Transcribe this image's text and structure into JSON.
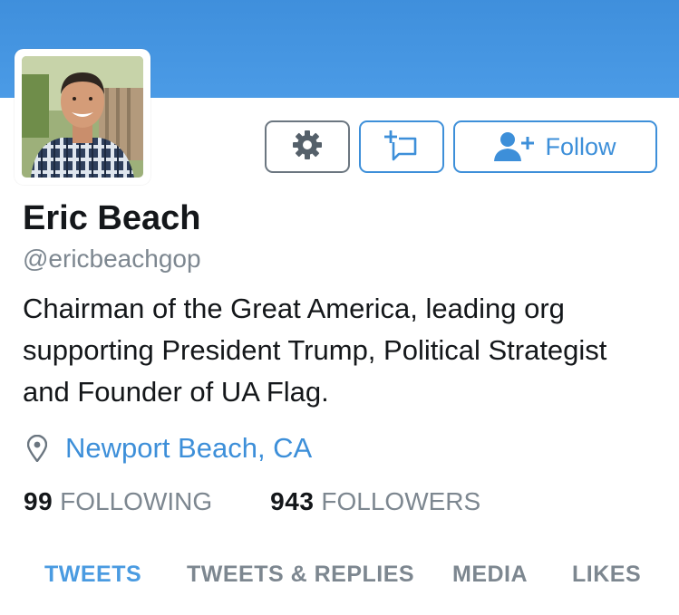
{
  "colors": {
    "banner": "#4b9be6",
    "accent": "#3d8fd9",
    "text_primary": "#14171a",
    "text_secondary": "#7d8790"
  },
  "profile": {
    "name": "Eric Beach",
    "handle": "@ericbeachgop",
    "bio": "Chairman of the Great America, leading org supporting President Trump, Political Strategist and Founder of UA Flag.",
    "location": "Newport Beach, CA"
  },
  "actions": {
    "settings_icon": "gear-icon",
    "message_icon": "compose-message-icon",
    "follow_icon": "add-user-icon",
    "follow_label": "Follow"
  },
  "stats": {
    "following_count": "99",
    "following_label": "FOLLOWING",
    "followers_count": "943",
    "followers_label": "FOLLOWERS"
  },
  "tabs": [
    {
      "label": "TWEETS",
      "active": true
    },
    {
      "label": "TWEETS & REPLIES",
      "active": false
    },
    {
      "label": "MEDIA",
      "active": false
    },
    {
      "label": "LIKES",
      "active": false
    }
  ]
}
